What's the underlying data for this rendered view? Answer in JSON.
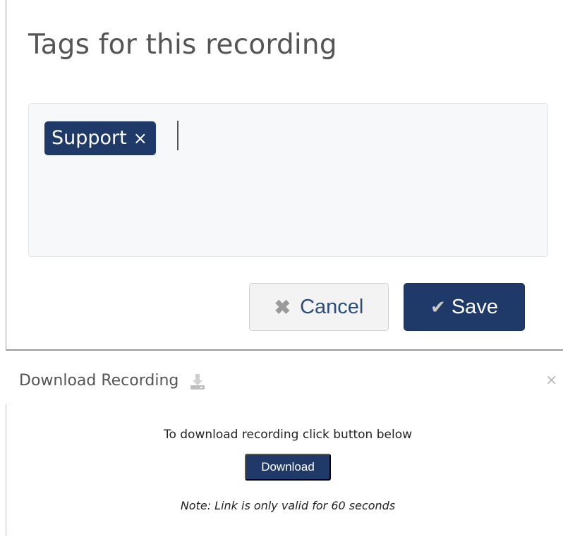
{
  "tags_panel": {
    "title": "Tags for this recording",
    "tags": [
      {
        "label": "Support",
        "remove_glyph": "×"
      }
    ],
    "cancel_button": {
      "label": "Cancel",
      "icon": "times-icon"
    },
    "save_button": {
      "label": "Save",
      "icon": "check-icon"
    }
  },
  "download_panel": {
    "title": "Download Recording",
    "title_icon": "download-tray-icon",
    "close_glyph": "×",
    "instruction": "To download recording click button below",
    "button_label": "Download",
    "note": "Note: Link is only valid for 60 seconds"
  },
  "colors": {
    "primary": "#1f3a68",
    "tag_box_bg": "#f7f8f9",
    "cancel_bg": "#f3f3f3",
    "cancel_text": "#2a4d7a",
    "border": "#9a9a9a"
  }
}
